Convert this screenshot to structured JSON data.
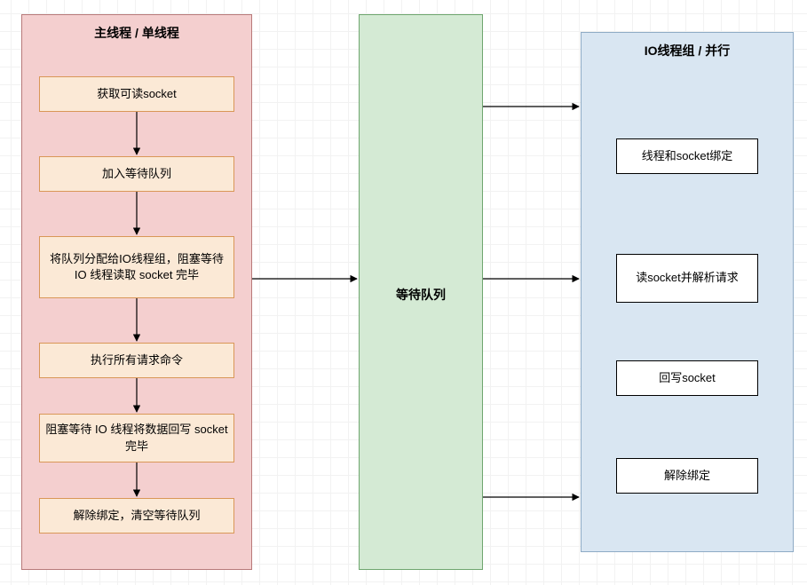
{
  "panels": {
    "main_thread": {
      "title": "主线程 / 单线程"
    },
    "wait_queue": {
      "label": "等待队列"
    },
    "io_group": {
      "title": "IO线程组 / 并行"
    }
  },
  "main_steps": {
    "s1": "获取可读socket",
    "s2": "加入等待队列",
    "s3": "将队列分配给IO线程组，阻塞等待 IO 线程读取 socket 完毕",
    "s4": "执行所有请求命令",
    "s5": "阻塞等待 IO 线程将数据回写 socket 完毕",
    "s6": "解除绑定，清空等待队列"
  },
  "io_steps": {
    "s1": "线程和socket绑定",
    "s2": "读socket并解析请求",
    "s3": "回写socket",
    "s4": "解除绑定"
  }
}
